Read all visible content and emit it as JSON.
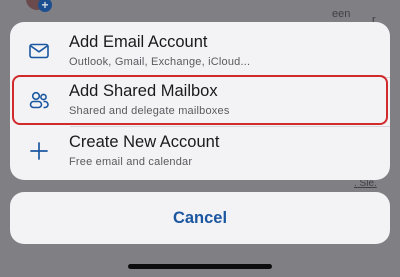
{
  "background": {
    "fragment_top_right_1": "een",
    "fragment_top_right_2": "r",
    "fragment_bottom_right": ". Sle."
  },
  "sheet": {
    "options": [
      {
        "title": "Add Email Account",
        "subtitle": "Outlook, Gmail, Exchange, iCloud...",
        "icon": "envelope-icon"
      },
      {
        "title": "Add Shared Mailbox",
        "subtitle": "Shared and delegate mailboxes",
        "icon": "people-icon",
        "highlighted": true
      },
      {
        "title": "Create New Account",
        "subtitle": "Free email and calendar",
        "icon": "plus-icon"
      }
    ]
  },
  "cancel": {
    "label": "Cancel"
  },
  "colors": {
    "accent": "#1b57a0",
    "highlight_border": "#d12a2a",
    "sheet_bg": "#f3f3f6",
    "dim_bg": "#7f7f84"
  }
}
